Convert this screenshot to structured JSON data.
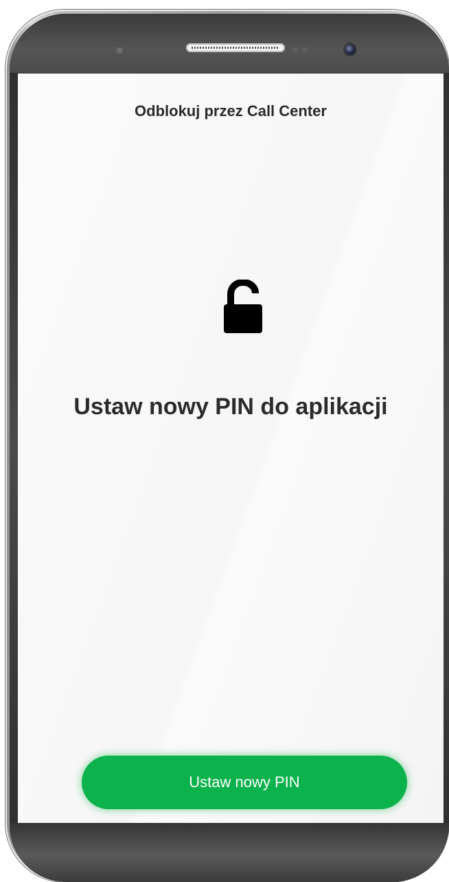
{
  "screen": {
    "title": "Odblokuj przez Call Center",
    "heading": "Ustaw nowy PIN do aplikacji",
    "icon": "unlocked-padlock-icon",
    "primary_button_label": "Ustaw nowy PIN"
  },
  "colors": {
    "accent": "#0cb24b",
    "text": "#2a2a2a",
    "background": "#f7f7f7"
  }
}
